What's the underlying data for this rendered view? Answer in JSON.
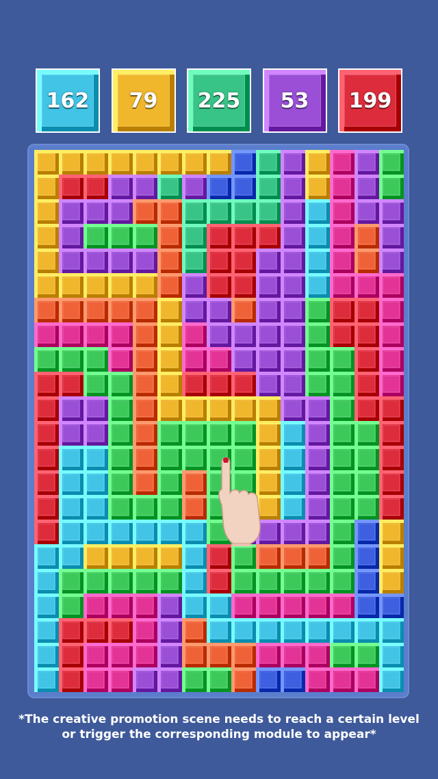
{
  "score_tiles": [
    {
      "value": "162",
      "color": "cyan"
    },
    {
      "value": "79",
      "color": "yellow"
    },
    {
      "value": "225",
      "color": "green"
    },
    {
      "value": "53",
      "color": "purple"
    },
    {
      "value": "199",
      "color": "red"
    }
  ],
  "palette": {
    "Y": "#f0b62c",
    "R": "#dd2c3c",
    "P": "#9a4fd6",
    "G": "#3cc95a",
    "C": "#41c4e6",
    "M": "#e33396",
    "O": "#ef6237",
    "B": "#3d5fe0",
    "T": "#38c486"
  },
  "board_rows": [
    "YYYYYYYYBTPYMPG",
    "YRRPPTPBBTPYMPG",
    "YPPPOOTTTTPCMPP",
    "YPGGGOTRRRPCMOP",
    "YPPPPOTRRPPCMOP",
    "YYYYYOPRRPPCMMM",
    "OOOOOYPPOPPGRRM",
    "MMMMOYMPPPPGRRM",
    "GGGMOYMMPPPGGRM",
    "RRGGOYRRRPPGGRM",
    "RPPGOYYYYYPPGRR",
    "RPPGOGGGGYCPGGR",
    "RCCGOGGGGYCPGGR",
    "RCCGOGOGGYCPGGR",
    "RCCGGGOGGYCPGGR",
    "RCCCCCCGPPPPGBY",
    "CCYYYYCRGOOOGBY",
    "CGGGGGCRGGGGGBY",
    "CGMMMPCCMMMMMBB",
    "CRRRMPOCCCCCCCC",
    "CRMMMPOOOMMMGGC",
    "CRMMPPGGOBBMMMC"
  ],
  "disclaimer_line1": "*The creative promotion scene needs to reach a certain level",
  "disclaimer_line2": "or trigger the corresponding module to appear*"
}
